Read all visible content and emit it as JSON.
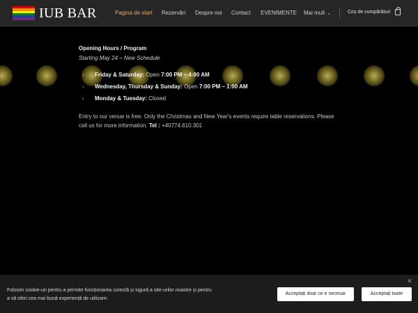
{
  "header": {
    "brand": "IUB BAR",
    "flag_colors": [
      "#e40303",
      "#ff8c00",
      "#ffed00",
      "#008026",
      "#24408e",
      "#732982"
    ],
    "nav": [
      {
        "label": "Pagina de start",
        "active": true
      },
      {
        "label": "Rezervări"
      },
      {
        "label": "Despre noi"
      },
      {
        "label": "Contact"
      },
      {
        "label": "EVENIMENTE"
      },
      {
        "label": "Mai mult"
      }
    ],
    "cart_label": "Coș de cumpărături"
  },
  "content": {
    "title": "Opening Hours / Program",
    "subtitle": "Starting May 24 – New Schedule",
    "schedule": [
      {
        "days": "Friday & Saturday:",
        "status": "Open",
        "hours": "7:00 PM – 4:00 AM"
      },
      {
        "days": "Wednesday, Thursday & Sunday:",
        "status": "Open",
        "hours": "7:00 PM – 1:00 AM"
      },
      {
        "days": "Monday & Tuesday:",
        "status": "Closed",
        "hours": ""
      }
    ],
    "info_text": "Entry to our venue is free. Only the Christmas and New Year's events require table reservations. Please call us for more information.",
    "tel_label": "Tel :",
    "tel_number": "+40774.610.301"
  },
  "cookie": {
    "text": "Folosim cookie-uri pentru a permite funcționarea corectă și sigură a site-urilor noastre și pentru a vă oferi cea mai bună experiență de utilizare.",
    "accept_necessary": "Acceptați doar ce e necesar",
    "accept_all": "Acceptați toate"
  }
}
